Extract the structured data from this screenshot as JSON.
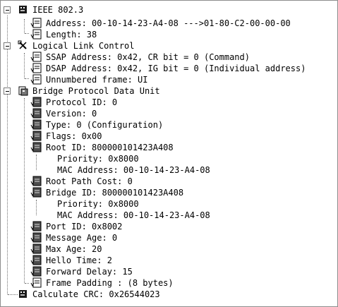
{
  "tree": {
    "ieee": {
      "label": "IEEE 802.3",
      "address": "Address: 00-10-14-23-A4-08 --->01-80-C2-00-00-00",
      "length": "Length: 38"
    },
    "llc": {
      "label": "Logical Link Control",
      "ssap": "SSAP Address: 0x42, CR bit = 0 (Command)",
      "dsap": "DSAP Address: 0x42, IG bit = 0 (Individual address)",
      "frame": "Unnumbered frame: UI"
    },
    "bpdu": {
      "label": "Bridge Protocol Data Unit",
      "protocol_id": "Protocol ID: 0",
      "version": "Version: 0",
      "type": "Type: 0 (Configuration)",
      "flags": "Flags: 0x00",
      "root_id": "Root ID: 800000101423A408",
      "root_priority": "Priority: 0x8000",
      "root_mac": "MAC Address: 00-10-14-23-A4-08",
      "root_path_cost": "Root Path Cost: 0",
      "bridge_id": "Bridge ID: 800000101423A408",
      "bridge_priority": "Priority: 0x8000",
      "bridge_mac": "MAC Address: 00-10-14-23-A4-08",
      "port_id": "Port ID: 0x8002",
      "message_age": "Message Age: 0",
      "max_age": "Max Age: 20",
      "hello_time": "Hello Time: 2",
      "forward_delay": "Forward Delay: 15",
      "padding": "Frame Padding : (8 bytes)"
    },
    "crc": "Calculate CRC: 0x26544023"
  },
  "icons": {
    "ieee": "network-packet-icon",
    "llc": "tools-icon",
    "bpdu": "bridge-protocol-icon",
    "crc": "network-packet-icon",
    "field": "document-field-icon",
    "bpdu_field": "dark-document-field-icon"
  }
}
